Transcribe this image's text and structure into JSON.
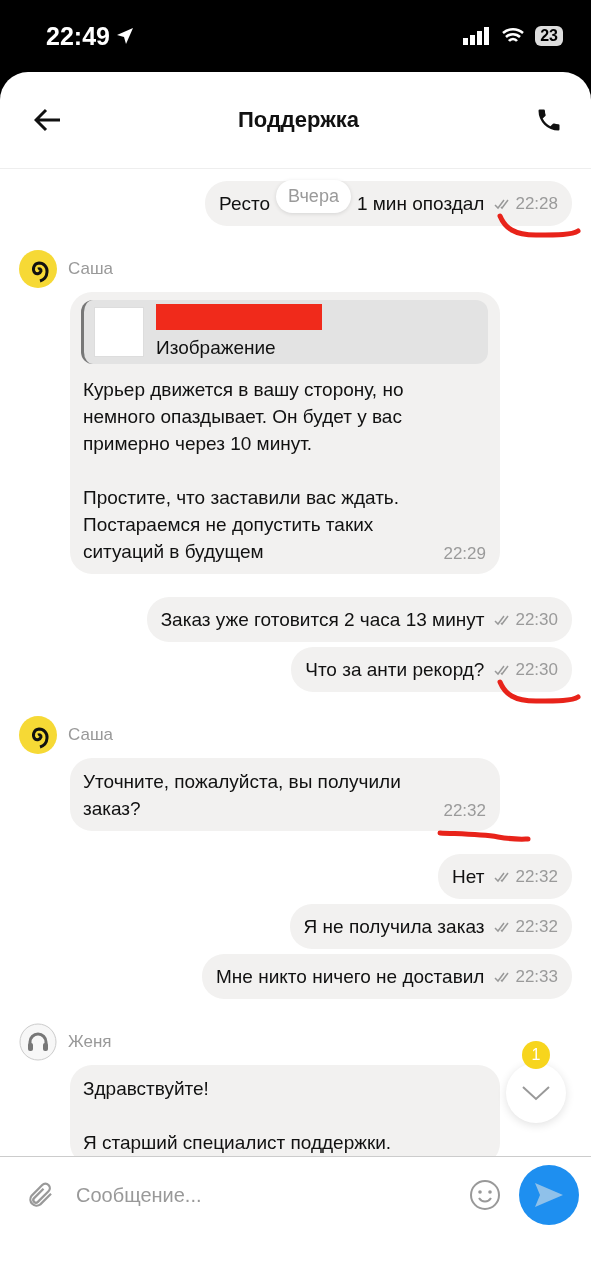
{
  "status_bar": {
    "time": "22:49",
    "battery": "23"
  },
  "header": {
    "title": "Поддержка"
  },
  "date_pill": "Вчера",
  "messages": [
    {
      "kind": "outgoing",
      "text_before": "Ресто",
      "text_after": "1 мин опоздал",
      "time": "22:28",
      "read": true,
      "marked": true
    },
    {
      "kind": "incoming",
      "sender": "Саша",
      "avatar": {
        "kind": "bot"
      },
      "attachment": {
        "label": "Изображение",
        "redacted": true
      },
      "text": "Курьер движется в вашу сторону, но\nнемного опаздывает. Он будет у вас\nпримерно через 10 минут.\n\nПростите, что заставили вас ждать.\nПостараемся не допустить таких\nситуаций в будущем",
      "time": "22:29",
      "marked": false
    },
    {
      "kind": "outgoing",
      "text": "Заказ уже готовится 2 часа 13 минут",
      "time": "22:30",
      "read": true,
      "marked": false
    },
    {
      "kind": "outgoing",
      "text": "Что за анти рекорд?",
      "time": "22:30",
      "read": true,
      "marked": true
    },
    {
      "kind": "incoming",
      "sender": "Саша",
      "avatar": {
        "kind": "bot"
      },
      "text": "Уточните, пожалуйста, вы получили\nзаказ?",
      "time": "22:32",
      "marked": true
    },
    {
      "kind": "outgoing",
      "text": "Нет",
      "time": "22:32",
      "read": true,
      "marked": false
    },
    {
      "kind": "outgoing",
      "text": "Я не получила заказ",
      "time": "22:32",
      "read": true,
      "marked": false
    },
    {
      "kind": "outgoing",
      "text": "Мне никто ничего не доставил",
      "time": "22:33",
      "read": true,
      "marked": false
    },
    {
      "kind": "incoming",
      "sender": "Женя",
      "avatar": {
        "kind": "agent"
      },
      "text": "Здравствуйте!\n\nЯ старший специалист поддержки.",
      "marked": false
    }
  ],
  "scroll_button": {
    "badge": "1"
  },
  "composer": {
    "placeholder": "Сообщение..."
  }
}
